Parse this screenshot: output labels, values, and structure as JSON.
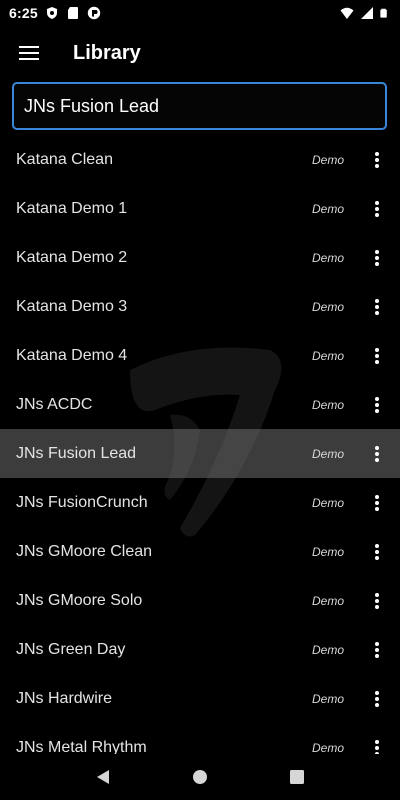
{
  "status_bar": {
    "time": "6:25",
    "icons": [
      "shield-notification-icon",
      "sd-card-icon",
      "app-notification-icon",
      "wifi-icon",
      "cellular-signal-icon",
      "battery-icon"
    ]
  },
  "app_bar": {
    "menu_icon": "hamburger-menu-icon",
    "title": "Library"
  },
  "search": {
    "value": "JNs Fusion Lead",
    "placeholder": ""
  },
  "presets": [
    {
      "name": "Katana Clean",
      "tag": "Demo",
      "selected": false
    },
    {
      "name": "Katana Demo 1",
      "tag": "Demo",
      "selected": false
    },
    {
      "name": "Katana Demo 2",
      "tag": "Demo",
      "selected": false
    },
    {
      "name": "Katana Demo 3",
      "tag": "Demo",
      "selected": false
    },
    {
      "name": "Katana Demo 4",
      "tag": "Demo",
      "selected": false
    },
    {
      "name": "JNs ACDC",
      "tag": "Demo",
      "selected": false
    },
    {
      "name": "JNs Fusion Lead",
      "tag": "Demo",
      "selected": true
    },
    {
      "name": "JNs FusionCrunch",
      "tag": "Demo",
      "selected": false
    },
    {
      "name": "JNs GMoore Clean",
      "tag": "Demo",
      "selected": false
    },
    {
      "name": "JNs GMoore Solo",
      "tag": "Demo",
      "selected": false
    },
    {
      "name": "JNs Green Day",
      "tag": "Demo",
      "selected": false
    },
    {
      "name": "JNs Hardwire",
      "tag": "Demo",
      "selected": false
    },
    {
      "name": "JNs Metal Rhythm",
      "tag": "Demo",
      "selected": false
    }
  ],
  "nav_bar": {
    "icons": [
      "back-icon",
      "home-icon",
      "recents-icon"
    ]
  },
  "colors": {
    "background": "#000000",
    "accent": "#3a86d8",
    "selected_row": "#5a5a5a"
  }
}
